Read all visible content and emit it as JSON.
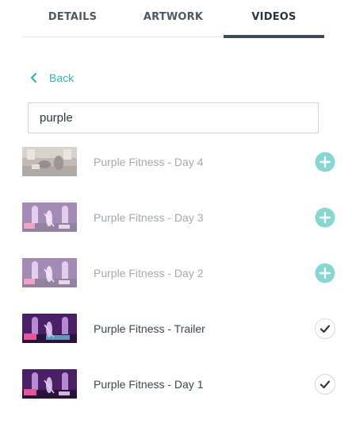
{
  "tabs": [
    {
      "label": "DETAILS",
      "active": false
    },
    {
      "label": "ARTWORK",
      "active": false
    },
    {
      "label": "VIDEOS",
      "active": true
    }
  ],
  "back": {
    "label": "Back",
    "icon": "chevron-left-icon"
  },
  "search": {
    "value": "purple"
  },
  "colors": {
    "accent": "#3bafb5",
    "add": "#5ec9c4",
    "text": "#3e4755",
    "muted": "#a4a9b0",
    "tab_underline": "#3e4b59"
  },
  "videos": [
    {
      "title": "Purple Fitness - Day 4",
      "added": false,
      "action_icon": "plus-circle-icon"
    },
    {
      "title": "Purple Fitness - Day 3",
      "added": false,
      "action_icon": "plus-circle-icon"
    },
    {
      "title": "Purple Fitness - Day 2",
      "added": false,
      "action_icon": "plus-circle-icon"
    },
    {
      "title": "Purple Fitness - Trailer",
      "added": true,
      "action_icon": "check-circle-icon"
    },
    {
      "title": "Purple Fitness - Day 1",
      "added": true,
      "action_icon": "check-circle-icon"
    }
  ]
}
